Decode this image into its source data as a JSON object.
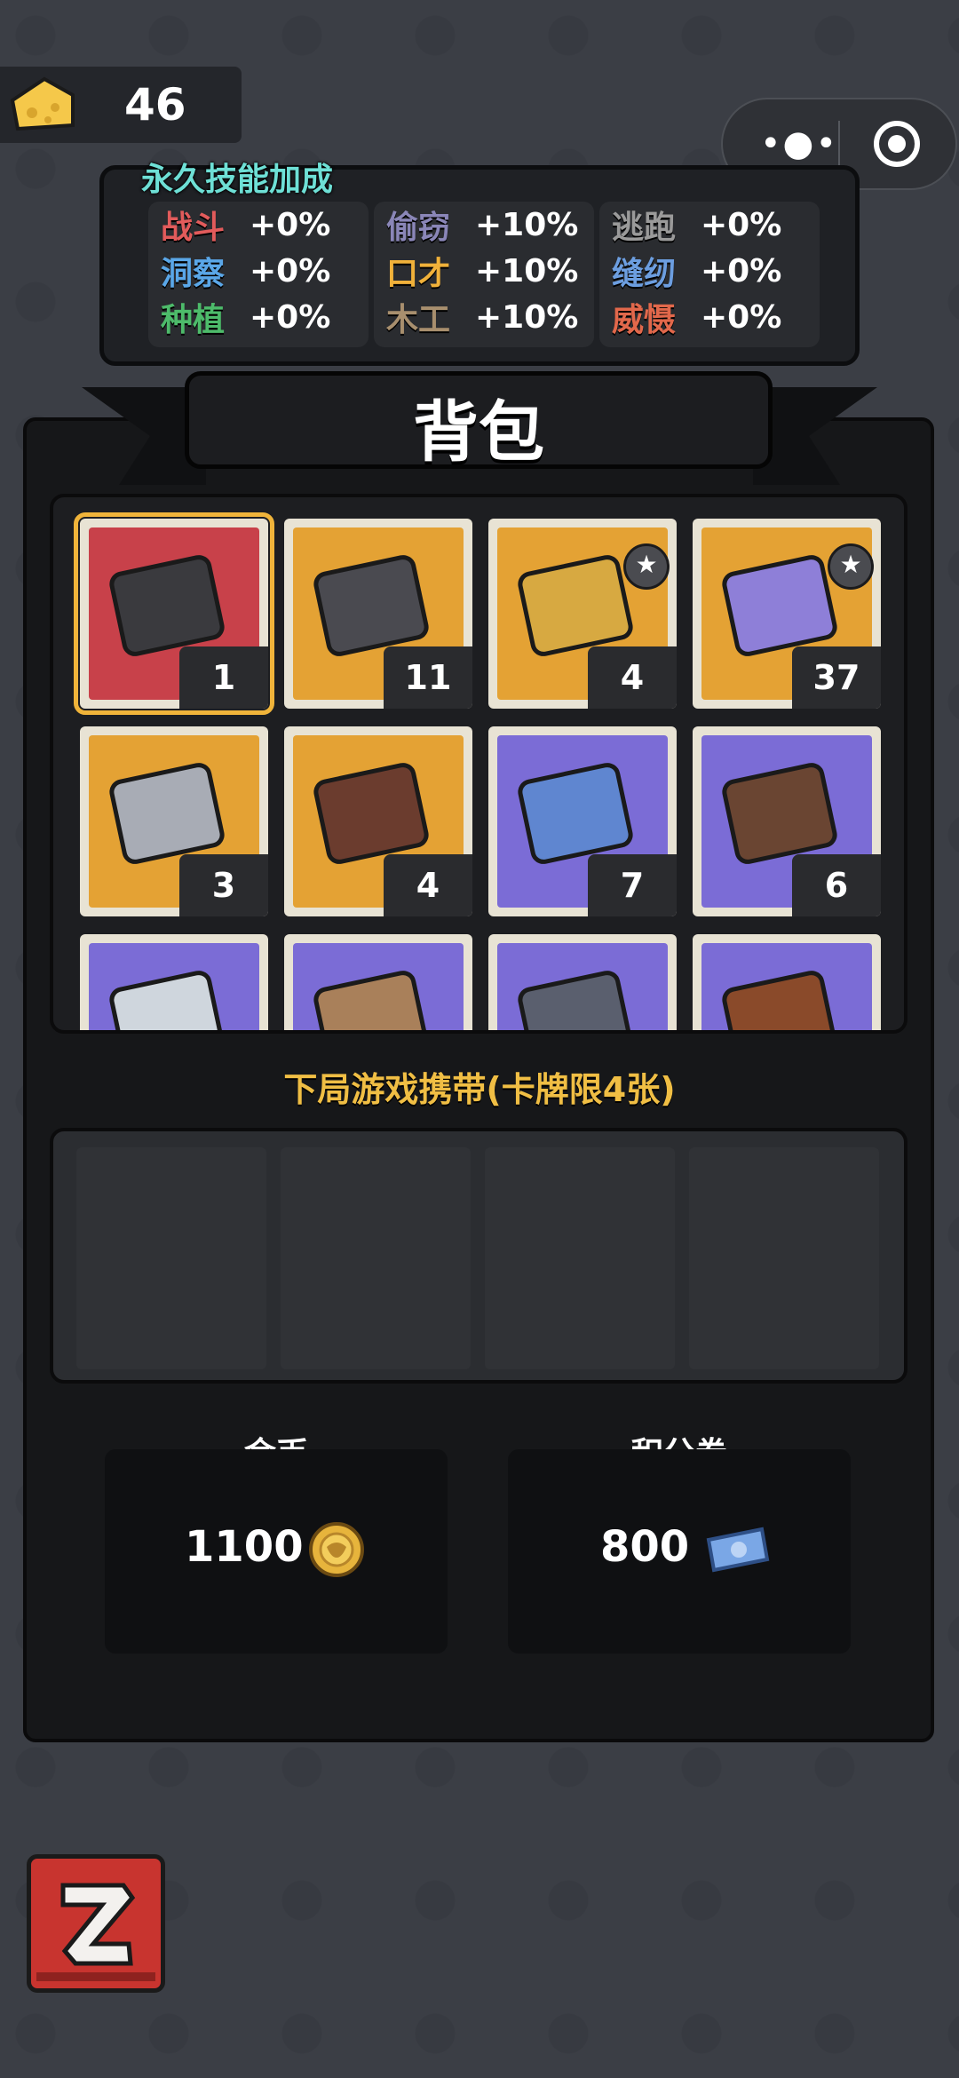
{
  "cheese": {
    "count": "46",
    "icon": "cheese-icon"
  },
  "capsule": {
    "more": "•●•"
  },
  "skills": {
    "title": "永久技能加成",
    "columns": [
      [
        {
          "name": "战斗",
          "value": "+0%",
          "color": "#e25b5b"
        },
        {
          "name": "洞察",
          "value": "+0%",
          "color": "#5aa7e8"
        },
        {
          "name": "种植",
          "value": "+0%",
          "color": "#4dbb6a"
        }
      ],
      [
        {
          "name": "偷窃",
          "value": "+10%",
          "color": "#8a86b8"
        },
        {
          "name": "口才",
          "value": "+10%",
          "color": "#f0b13a"
        },
        {
          "name": "木工",
          "value": "+10%",
          "color": "#a88f6e"
        }
      ],
      [
        {
          "name": "逃跑",
          "value": "+0%",
          "color": "#9a9a9a"
        },
        {
          "name": "缝纫",
          "value": "+0%",
          "color": "#6c9ee0"
        },
        {
          "name": "威慑",
          "value": "+0%",
          "color": "#e2684b"
        }
      ]
    ]
  },
  "panel": {
    "title": "背包"
  },
  "items": [
    {
      "name": "gift-box",
      "bg": "#c8414a",
      "count": "1",
      "selected": true,
      "star": false
    },
    {
      "name": "packaged-card",
      "bg": "#e4a234",
      "count": "11",
      "selected": false,
      "star": false
    },
    {
      "name": "gold-card",
      "bg": "#e4a234",
      "count": "4",
      "selected": false,
      "star": true
    },
    {
      "name": "purple-card",
      "bg": "#e4a234",
      "count": "37",
      "selected": false,
      "star": true
    },
    {
      "name": "stone-mouse",
      "bg": "#e4a234",
      "count": "3",
      "selected": false,
      "star": false
    },
    {
      "name": "steak-poster",
      "bg": "#e4a234",
      "count": "4",
      "selected": false,
      "star": false
    },
    {
      "name": "ticket-bag",
      "bg": "#7b6cd6",
      "count": "7",
      "selected": false,
      "star": false
    },
    {
      "name": "wallet",
      "bg": "#7b6cd6",
      "count": "6",
      "selected": false,
      "star": false
    },
    {
      "name": "medkit",
      "bg": "#7b6cd6",
      "count": "",
      "selected": false,
      "star": false
    },
    {
      "name": "paper-bag",
      "bg": "#7b6cd6",
      "count": "",
      "selected": false,
      "star": false
    },
    {
      "name": "lunchbox",
      "bg": "#7b6cd6",
      "count": "",
      "selected": false,
      "star": false
    },
    {
      "name": "bottle",
      "bg": "#7b6cd6",
      "count": "",
      "selected": false,
      "star": false
    }
  ],
  "carry": {
    "title": "下局游戏携带(卡牌限4张)"
  },
  "resources": {
    "gold": {
      "label": "金币",
      "value": "1100",
      "icon": "coin-icon"
    },
    "points": {
      "label": "积分券",
      "value": "800",
      "icon": "ticket-icon"
    }
  },
  "back_icon": "back-arrow-icon"
}
